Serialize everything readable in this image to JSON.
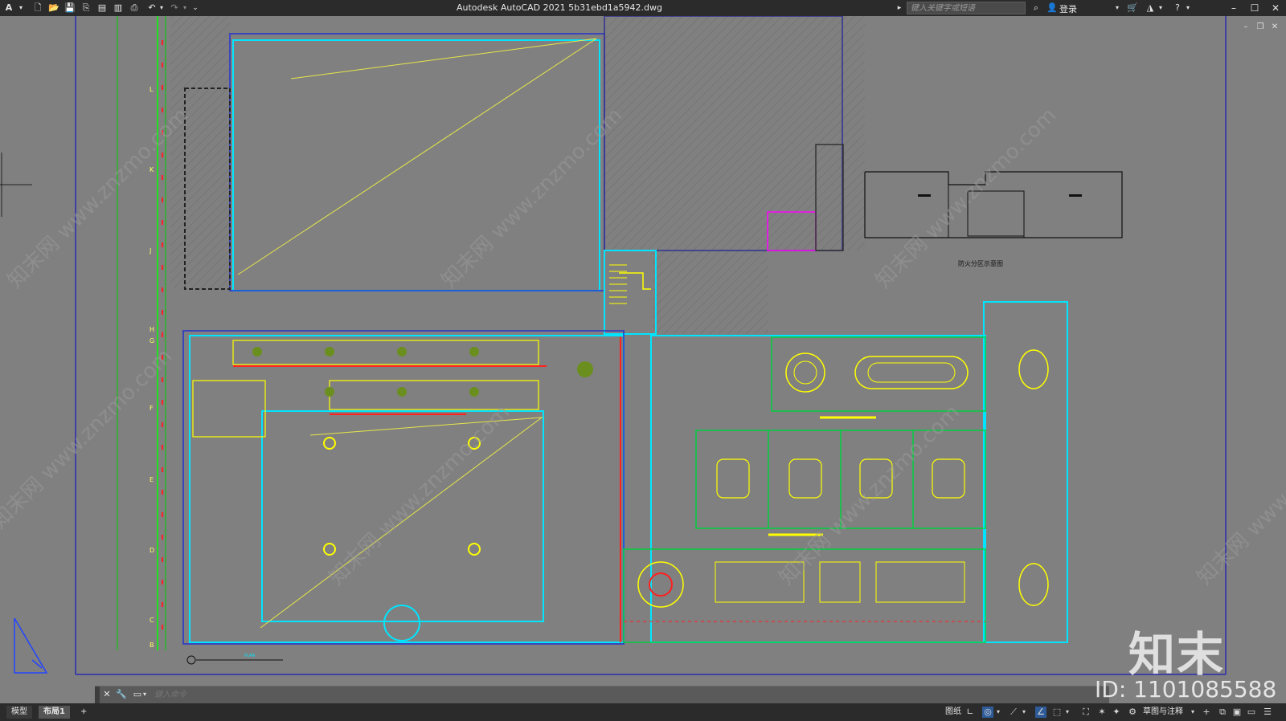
{
  "titlebar": {
    "app_logo": "A",
    "title": "Autodesk AutoCAD 2021    5b31ebd1a5942.dwg",
    "search_placeholder": "键入关键字或短语",
    "login": "登录",
    "icons": [
      "new-icon",
      "open-icon",
      "save-icon",
      "save-as-icon",
      "publish-icon",
      "plot-preview-icon",
      "print-icon",
      "undo-icon",
      "redo-icon",
      "qat-dropdown-icon",
      "search-icon",
      "user-icon",
      "cart-icon",
      "a360-icon",
      "help-icon",
      "minimize-icon",
      "maximize-icon",
      "close-icon"
    ]
  },
  "drawing": {
    "diagram_label": "防火分区示意图",
    "grid_labels": [
      "L",
      "K",
      "J",
      "H",
      "G",
      "F",
      "E",
      "D",
      "C",
      "B"
    ],
    "scale_bar_label": "PLAN",
    "colors": {
      "background": "#808080",
      "walls_cyan": "#00ffff",
      "furniture_yellow": "#ffff00",
      "red_lines": "#ff0000",
      "green_lines": "#00ff00",
      "blue_lines": "#0000cc",
      "hatch_dark": "#5a5a5a"
    }
  },
  "commandline": {
    "placeholder": "键入命令"
  },
  "statusbar": {
    "tab_model": "模型",
    "tab_layout1": "布局1",
    "tab_add": "+",
    "paper_label": "图纸",
    "workspace_label": "草图与注释"
  },
  "watermark": {
    "logo": "知末",
    "id_text": "ID: 1101085588",
    "diagonal_text": "知末网 www.znzmo.com"
  }
}
